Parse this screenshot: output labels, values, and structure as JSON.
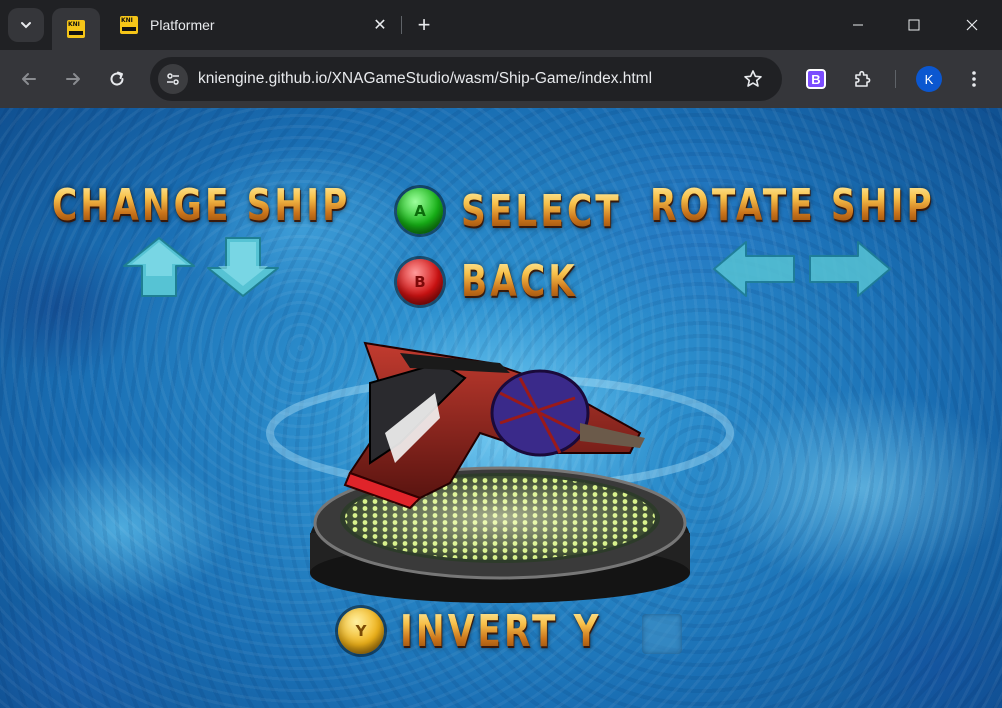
{
  "browser": {
    "tab_search_icon": "chevron-down-icon",
    "tabs": [
      {
        "title": "",
        "favicon": "kni-logo-icon",
        "active": true
      },
      {
        "title": "Platformer",
        "favicon": "kni-logo-icon",
        "active": false
      }
    ],
    "tab_close": "✕",
    "new_tab": "+",
    "omnibox": {
      "url": "kniengine.github.io/XNAGameStudio/wasm/Ship-Game/index.html"
    },
    "extension_label": "B",
    "profile_initial": "K",
    "colors": {
      "chrome_dark": "#202124",
      "chrome_toolbar": "#35363a",
      "profile": "#0b57d0"
    }
  },
  "game": {
    "change_ship": "CHANGE SHIP",
    "select": "SELECT",
    "back": "BACK",
    "rotate_ship": "ROTATE SHIP",
    "invert_y": "INVERT Y",
    "orb_a": "A",
    "orb_b": "B",
    "orb_y": "Y",
    "invert_y_enabled": false,
    "colors": {
      "text_gold": "#f7c04a",
      "arrow_cyan": "#5fd0e0",
      "orb_a": "#17b417",
      "orb_b": "#d11313",
      "orb_y": "#f0b31a"
    }
  }
}
